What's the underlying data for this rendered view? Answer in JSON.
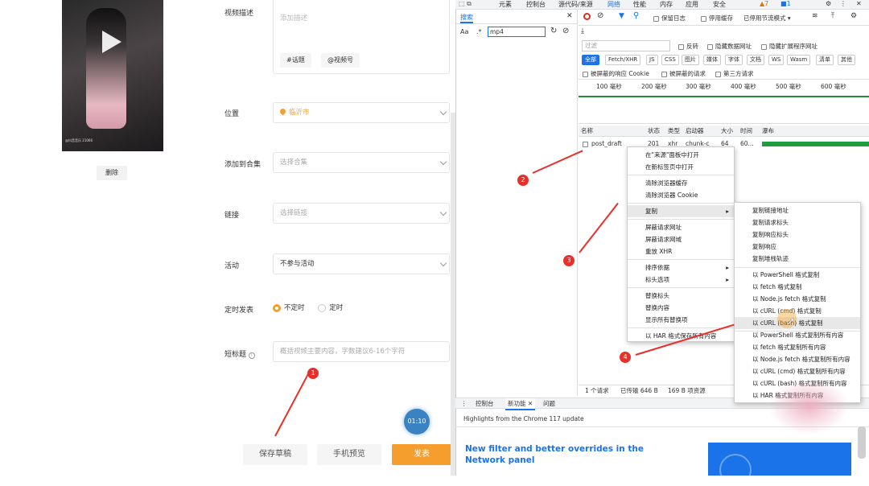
{
  "form": {
    "video_caption": "@抖音音乐 21066",
    "delete_label": "删除",
    "desc_label": "视频描述",
    "desc_placeholder": "添加描述",
    "tag_topic": "#话题",
    "tag_friend": "@视频号",
    "location_label": "位置",
    "location_value": "临沂市",
    "collection_label": "添加到合集",
    "collection_placeholder": "选择合集",
    "link_label": "链接",
    "link_placeholder": "选择链接",
    "activity_label": "活动",
    "activity_value": "不参与活动",
    "schedule_label": "定时发表",
    "schedule_off": "不定时",
    "schedule_on": "定时",
    "short_title_label": "短标题",
    "short_title_placeholder": "概括视频主要内容，字数建议6-16个字符",
    "save_draft": "保存草稿",
    "phone_preview": "手机预览",
    "publish": "发表",
    "timer_badge": "01:10"
  },
  "devtools": {
    "tabs": [
      "元素",
      "控制台",
      "源代码/来源",
      "网络",
      "性能",
      "内存",
      "应用",
      "安全"
    ],
    "warn_count": "7",
    "err_count": "1",
    "search_tab": "搜索",
    "search_aa": "Aa",
    "search_regex": ".*",
    "search_value": "mp4",
    "toolbar": {
      "preserve_log": "保留日志",
      "disable_cache": "停用缓存",
      "throttle": "已停用节流模式"
    },
    "filter_placeholder": "过滤",
    "filter_opts": [
      "反转",
      "隐藏数据网址",
      "隐藏扩展程序网址"
    ],
    "chips": [
      "全部",
      "Fetch/XHR",
      "JS",
      "CSS",
      "图片",
      "媒体",
      "字体",
      "文档",
      "WS",
      "Wasm",
      "清单",
      "其他"
    ],
    "filter_opts2": [
      "被屏蔽的响应 Cookie",
      "被屏蔽的请求",
      "第三方请求"
    ],
    "timeline": [
      "100 毫秒",
      "200 毫秒",
      "300 毫秒",
      "400 毫秒",
      "500 毫秒",
      "600 毫秒"
    ],
    "cols": [
      "名称",
      "状态",
      "类型",
      "启动器",
      "大小",
      "时间",
      "瀑布"
    ],
    "row": {
      "name": "post_draft",
      "status": "201",
      "type": "xhr",
      "initiator": "chunk-c",
      "size": "64",
      "time": "60..."
    },
    "status": {
      "reqs": "1 个请求",
      "transferred": "已传输 646 B",
      "resources": "169 B 项资源"
    },
    "drawer_tabs": [
      "控制台",
      "新功能",
      "问题"
    ],
    "highlight": "Highlights from the Chrome 117 update",
    "news_title": "New filter and better overrides in the Network panel"
  },
  "context_menu": [
    "在\"来源\"面板中打开",
    "在新标签页中打开",
    "清除浏览器缓存",
    "清除浏览器 Cookie",
    "复制",
    "屏蔽请求网址",
    "屏蔽请求网域",
    "重放 XHR",
    "排序依据",
    "标头选项",
    "替换标头",
    "替换内容",
    "显示所有替换项",
    "以 HAR 格式保存所有内容"
  ],
  "copy_submenu": [
    "复制链接地址",
    "复制请求标头",
    "复制响应标头",
    "复制响应",
    "复制堆栈轨迹",
    "以 PowerShell 格式复制",
    "以 fetch 格式复制",
    "以 Node.js fetch 格式复制",
    "以 cURL (cmd) 格式复制",
    "以 cURL (bash) 格式复制",
    "以 PowerShell 格式复制所有内容",
    "以 fetch 格式复制所有内容",
    "以 Node.js fetch 格式复制所有内容",
    "以 cURL (cmd) 格式复制所有内容",
    "以 cURL (bash) 格式复制所有内容",
    "以 HAR 格式复制所有内容"
  ],
  "steps": [
    "1",
    "2",
    "3",
    "4"
  ],
  "colors": {
    "accent": "#f59e2e",
    "annotation": "#e8302a",
    "devtools_blue": "#1a73e8"
  }
}
